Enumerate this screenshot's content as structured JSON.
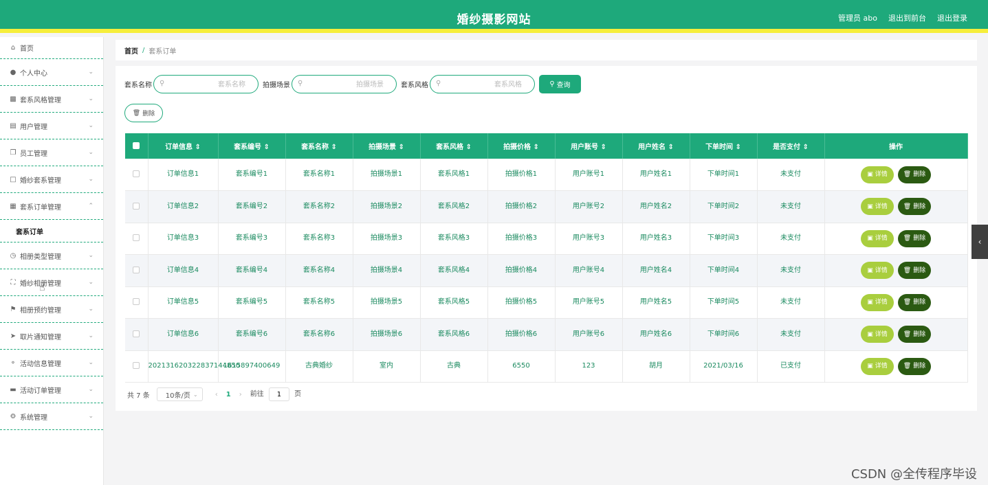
{
  "header": {
    "title": "婚纱摄影网站",
    "admin_label": "管理员 abo",
    "to_front_label": "退出到前台",
    "logout_label": "退出登录"
  },
  "sidebar": {
    "items": [
      {
        "label": "首页",
        "icon": "home-icon"
      },
      {
        "label": "个人中心",
        "icon": "user-icon"
      },
      {
        "label": "套系风格管理",
        "icon": "briefcase-icon"
      },
      {
        "label": "用户管理",
        "icon": "clipboard-icon"
      },
      {
        "label": "员工管理",
        "icon": "copy-icon"
      },
      {
        "label": "婚纱套系管理",
        "icon": "message-icon"
      },
      {
        "label": "套系订单管理",
        "icon": "grid-icon"
      },
      {
        "label": "相册类型管理",
        "icon": "clock-icon"
      },
      {
        "label": "婚纱相册管理",
        "icon": "fullscreen-icon"
      },
      {
        "label": "相册预约管理",
        "icon": "flag-icon"
      },
      {
        "label": "取片通知管理",
        "icon": "send-icon"
      },
      {
        "label": "活动信息管理",
        "icon": "mic-icon"
      },
      {
        "label": "活动订单管理",
        "icon": "ticket-icon"
      },
      {
        "label": "系统管理",
        "icon": "settings-icon"
      }
    ],
    "active_sub": "套系订单"
  },
  "breadcrumb": {
    "home": "首页",
    "sep": "/",
    "current": "套系订单"
  },
  "search": {
    "name_label": "套系名称",
    "name_placeholder": "套系名称",
    "scene_label": "拍摄场景",
    "scene_placeholder": "拍摄场景",
    "style_label": "套系风格",
    "style_placeholder": "套系风格",
    "query_label": "查询",
    "delete_label": "删除"
  },
  "table": {
    "headers": [
      "订单信息",
      "套系编号",
      "套系名称",
      "拍摄场景",
      "套系风格",
      "拍摄价格",
      "用户账号",
      "用户姓名",
      "下单时间",
      "是否支付",
      "操作"
    ],
    "detail_label": "详情",
    "delete_label": "删除",
    "rows": [
      [
        "订单信息1",
        "套系编号1",
        "套系名称1",
        "拍摄场景1",
        "套系风格1",
        "拍摄价格1",
        "用户账号1",
        "用户姓名1",
        "下单时间1",
        "未支付"
      ],
      [
        "订单信息2",
        "套系编号2",
        "套系名称2",
        "拍摄场景2",
        "套系风格2",
        "拍摄价格2",
        "用户账号2",
        "用户姓名2",
        "下单时间2",
        "未支付"
      ],
      [
        "订单信息3",
        "套系编号3",
        "套系名称3",
        "拍摄场景3",
        "套系风格3",
        "拍摄价格3",
        "用户账号3",
        "用户姓名3",
        "下单时间3",
        "未支付"
      ],
      [
        "订单信息4",
        "套系编号4",
        "套系名称4",
        "拍摄场景4",
        "套系风格4",
        "拍摄价格4",
        "用户账号4",
        "用户姓名4",
        "下单时间4",
        "未支付"
      ],
      [
        "订单信息5",
        "套系编号5",
        "套系名称5",
        "拍摄场景5",
        "套系风格5",
        "拍摄价格5",
        "用户账号5",
        "用户姓名5",
        "下单时间5",
        "未支付"
      ],
      [
        "订单信息6",
        "套系编号6",
        "套系名称6",
        "拍摄场景6",
        "套系风格6",
        "拍摄价格6",
        "用户账号6",
        "用户姓名6",
        "下单时间6",
        "未支付"
      ],
      [
        "202131620322837144850",
        "1615897400649",
        "古典婚纱",
        "室内",
        "古典",
        "6550",
        "123",
        "胡月",
        "2021/03/16",
        "已支付"
      ]
    ]
  },
  "pager": {
    "total": "共 7 条",
    "page_size": "10条/页",
    "current_page": "1",
    "goto_label": "前往",
    "goto_value": "1",
    "page_suffix": "页"
  },
  "watermark": "CSDN @全传程序毕设",
  "colors": {
    "primary": "#1ea97b",
    "accent_bar": "#f6ee3b",
    "detail_btn": "#a9ce3e",
    "delete_btn": "#2b5a12"
  }
}
